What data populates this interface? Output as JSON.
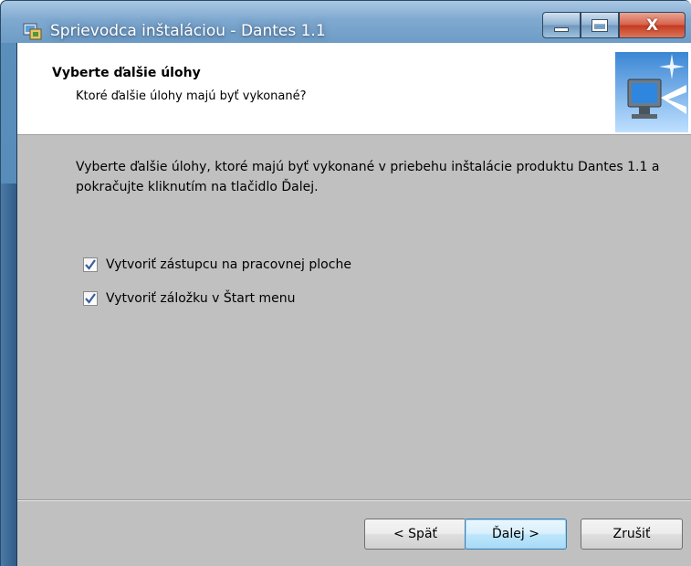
{
  "window": {
    "title": "Sprievodca inštaláciou - Dantes 1.1",
    "close_glyph": "X"
  },
  "header": {
    "title": "Vyberte ďalšie úlohy",
    "subtitle": "Ktoré ďalšie úlohy majú byť vykonané?"
  },
  "main": {
    "description": "Vyberte ďalšie úlohy, ktoré majú byť vykonané v priebehu inštalácie produktu Dantes 1.1 a pokračujte kliknutím na tlačidlo Ďalej.",
    "tasks": [
      {
        "label": "Vytvoriť zástupcu na pracovnej ploche",
        "checked": true
      },
      {
        "label": "Vytvoriť záložku v Štart menu",
        "checked": true
      }
    ]
  },
  "footer": {
    "back_label": "< Späť",
    "next_label": "Ďalej >",
    "cancel_label": "Zrušiť"
  },
  "colors": {
    "client_bg": "#c0c0c0",
    "check_mark": "#3a5f9a"
  }
}
